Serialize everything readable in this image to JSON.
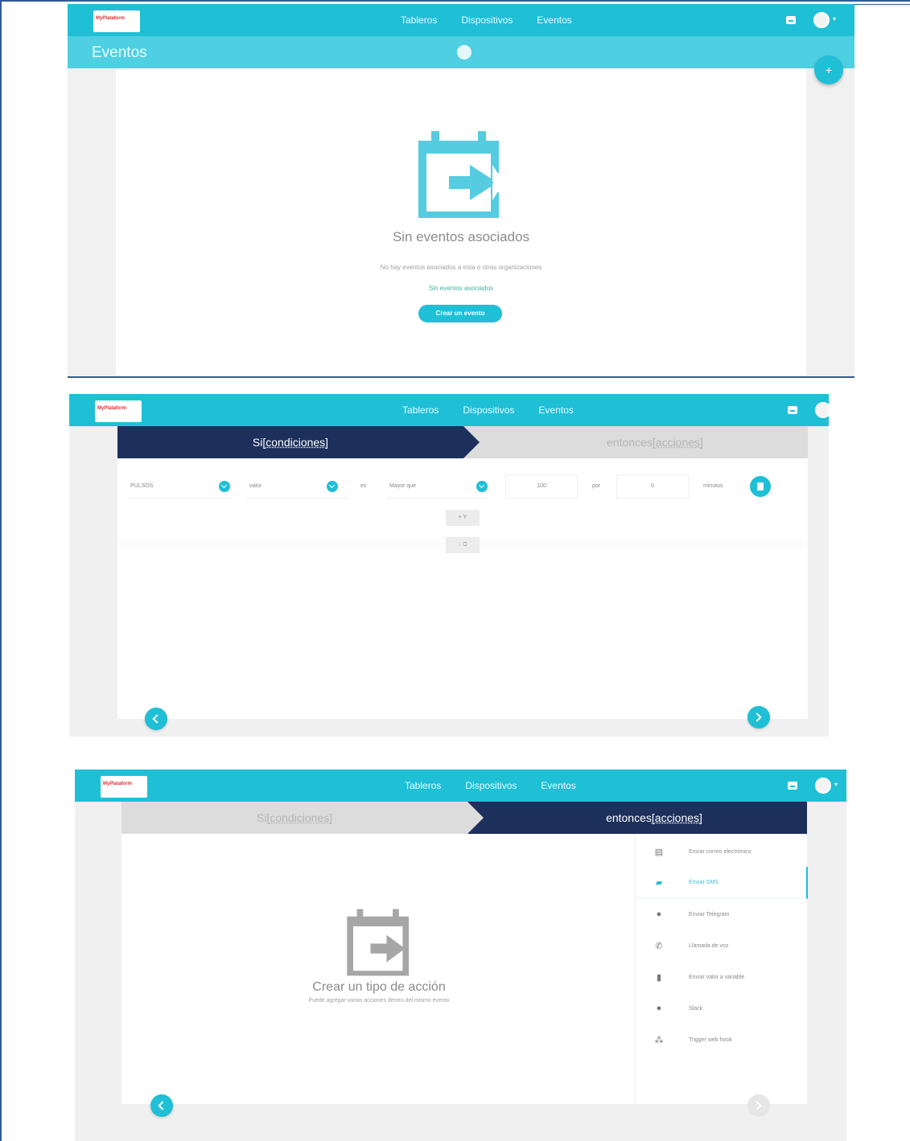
{
  "nav": {
    "logo": "MyPlataform",
    "links": [
      "Tableros",
      "Dispositivos",
      "Eventos"
    ]
  },
  "screen1": {
    "page_title": "Eventos",
    "add_button": "+",
    "empty_title": "Sin eventos asociados",
    "empty_desc": "No hay eventos asociados a esta o otras organizaciones",
    "empty_link": "Sin eventos asociados",
    "create_button": "Crear un evento"
  },
  "wizard": {
    "cond_prefix": "Si ",
    "cond_bracket": "[condiciones]",
    "act_prefix": "entonces ",
    "act_bracket": "[acciones]"
  },
  "screen2": {
    "device": "PULSOS",
    "variable": "valor",
    "connector_es": "es",
    "operator": "Mayor que",
    "value": "100",
    "connector_por": "por",
    "duration": "0",
    "unit": "minutos",
    "add_y": "+ Y",
    "add_o": "+ O"
  },
  "screen3": {
    "menu": [
      {
        "icon": "print-icon",
        "glyph": "▤",
        "label": "Enviar correo electrónico"
      },
      {
        "icon": "sms-icon",
        "glyph": "▰",
        "label": "Enviar SMS"
      },
      {
        "icon": "telegram-icon",
        "glyph": "●",
        "label": "Enviar Telegram"
      },
      {
        "icon": "phone-icon",
        "glyph": "✆",
        "label": "Llamada de voz"
      },
      {
        "icon": "bar-chart-icon",
        "glyph": "▮",
        "label": "Enviar valor a variable"
      },
      {
        "icon": "slack-icon",
        "glyph": "●",
        "label": "Slack"
      },
      {
        "icon": "webhook-icon",
        "glyph": "⁂",
        "label": "Trigger web hook"
      }
    ],
    "empty_title": "Crear un tipo de acción",
    "empty_desc": "Puede agregar varias acciones dentro del mismo evento"
  },
  "colors": {
    "brand": "#1fbfd6",
    "dark_navy": "#1d2f5b",
    "placeholder_icon": "#55cce0",
    "gray_icon": "#a6a6a6"
  }
}
